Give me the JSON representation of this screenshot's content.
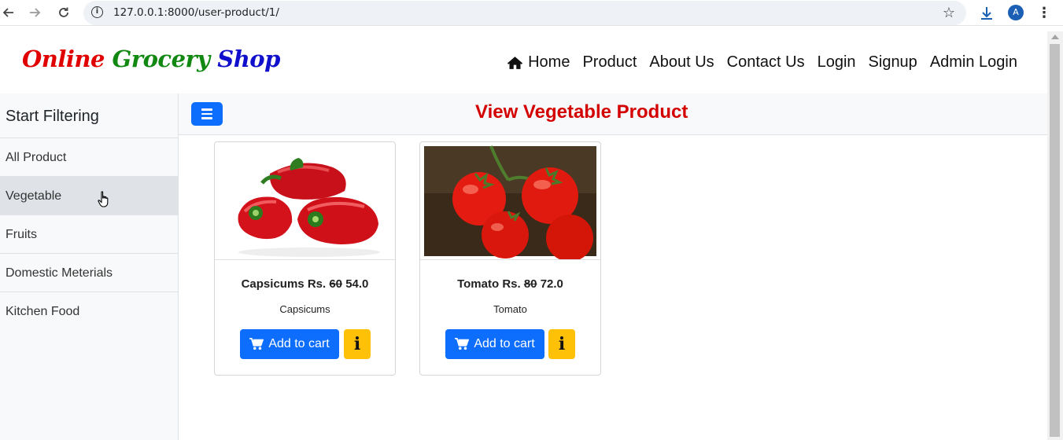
{
  "browser": {
    "url": "127.0.0.1:8000/user-product/1/",
    "profile_initial": "A"
  },
  "brand": {
    "part1": "Online",
    "part2": "Grocery",
    "part3": "Shop"
  },
  "nav": {
    "items": [
      "Home",
      "Product",
      "About Us",
      "Contact Us",
      "Login",
      "Signup",
      "Admin Login"
    ]
  },
  "sidebar": {
    "heading": "Start Filtering",
    "items": [
      "All Product",
      "Vegetable",
      "Fruits",
      "Domestic Meterials",
      "Kitchen Food"
    ],
    "active_item": "Vegetable"
  },
  "page": {
    "title": "View Vegetable Product"
  },
  "products": [
    {
      "name": "Capsicums",
      "currency_label": "Rs.",
      "old_price": "60",
      "price": "54.0",
      "subtitle": "Capsicums",
      "cart_label": "Add to cart",
      "info_label": "i"
    },
    {
      "name": "Tomato",
      "currency_label": "Rs.",
      "old_price": "80",
      "price": "72.0",
      "subtitle": "Tomato",
      "cart_label": "Add to cart",
      "info_label": "i"
    }
  ],
  "colors": {
    "primary": "#0d6efd",
    "warning": "#ffc107",
    "title_red": "#d40000",
    "brand_red": "#e00000",
    "brand_green": "#118811",
    "brand_blue": "#1010cc"
  },
  "icons": [
    "back-arrow-icon",
    "forward-arrow-icon",
    "reload-icon",
    "site-info-icon",
    "bookmark-star-icon",
    "download-icon",
    "menu-kebab-icon",
    "home-icon",
    "hamburger-icon",
    "cart-icon",
    "info-icon"
  ]
}
